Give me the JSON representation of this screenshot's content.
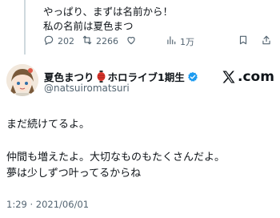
{
  "previous_tweet": {
    "text_line1": "やっぱり、まずは名前から！",
    "text_line2": "私の名前は夏色まつ"
  },
  "actions": {
    "replies": "202",
    "retweets": "2266",
    "likes": "",
    "views": "1万"
  },
  "author": {
    "name": "夏色まつり",
    "badge_text": "ホロライブ1期生",
    "handle": "@natsuiromatsuri"
  },
  "brand": {
    "logo_text": ".com"
  },
  "tweet": {
    "line1": "まだ続けてるよ。",
    "line2": "仲間も増えたよ。大切なものもたくさんだよ。",
    "line3": "夢は少しずつ叶ってるからね"
  },
  "timestamp": "1:29 · 2021/06/01",
  "colors": {
    "verified": "#1d9bf0",
    "secondary_text": "#536471",
    "thread_line": "#cfd9de"
  }
}
